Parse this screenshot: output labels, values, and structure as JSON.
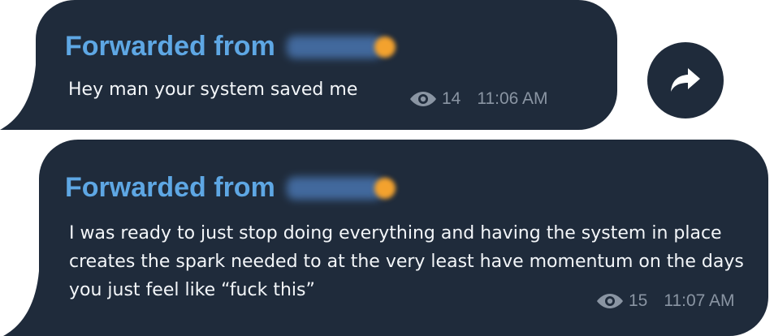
{
  "messages": [
    {
      "forward_label": "Forwarded from",
      "text": "Hey man your system saved me",
      "views": "14",
      "time": "11:06 AM"
    },
    {
      "forward_label": "Forwarded from",
      "text": "I was ready to just stop doing everything and having the system in place creates the spark needed to at the very least have momentum on the days you just feel like “fuck this”",
      "views": "15",
      "time": "11:07 AM"
    }
  ],
  "icons": {
    "views": "eye-icon",
    "share": "share-arrow-icon"
  },
  "colors": {
    "bubble": "#1f2b3b",
    "forward_label": "#5ea7e4",
    "text": "#f3f6f9",
    "meta": "#8a95a3"
  }
}
